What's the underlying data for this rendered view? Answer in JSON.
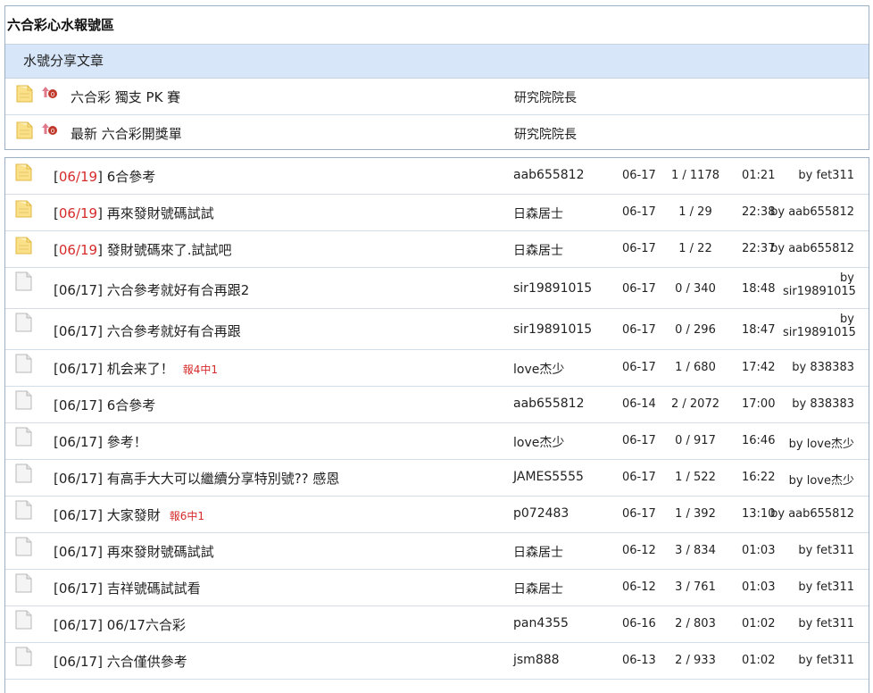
{
  "board": {
    "title": "六合彩心水報號區",
    "section_title": "水號分享文章",
    "pinned": [
      {
        "title": "六合彩 獨支 PK 賽",
        "author": "研究院院長"
      },
      {
        "title": "最新 六合彩開獎單",
        "author": "研究院院長"
      }
    ]
  },
  "colors": {
    "accent_red": "#d62b2b",
    "section_bg": "#d7e7f9",
    "border": "#9bb0c4"
  },
  "threads": [
    {
      "icon": "folder-new-icon",
      "date": "06/19",
      "hot": true,
      "title": "6合參考",
      "prize": "",
      "author": "aab655812",
      "posted": "06-17",
      "stats": "1 / 1178",
      "time": "01:21",
      "by": "by",
      "last_user": "fet311"
    },
    {
      "icon": "folder-new-icon",
      "date": "06/19",
      "hot": true,
      "title": "再來發財號碼試試",
      "prize": "",
      "author": "日森居士",
      "posted": "06-17",
      "stats": "1 / 29",
      "time": "22:38",
      "by": "by",
      "last_user": "aab655812"
    },
    {
      "icon": "folder-new-icon",
      "date": "06/19",
      "hot": true,
      "title": "發財號碼來了.試試吧",
      "prize": "",
      "author": "日森居士",
      "posted": "06-17",
      "stats": "1 / 22",
      "time": "22:37",
      "by": "by",
      "last_user": "aab655812"
    },
    {
      "icon": "document-icon",
      "date": "06/17",
      "hot": false,
      "title": "六合參考就好有合再跟2",
      "prize": "",
      "author": "sir19891015",
      "posted": "06-17",
      "stats": "0 / 340",
      "time": "18:48",
      "by": "by",
      "last_user": "sir19891015",
      "tall": true
    },
    {
      "icon": "document-icon",
      "date": "06/17",
      "hot": false,
      "title": "六合參考就好有合再跟",
      "prize": "",
      "author": "sir19891015",
      "posted": "06-17",
      "stats": "0 / 296",
      "time": "18:47",
      "by": "by",
      "last_user": "sir19891015",
      "tall": true
    },
    {
      "icon": "document-icon",
      "date": "06/17",
      "hot": false,
      "title": "机会来了！",
      "prize": "報4中1",
      "author": "love杰少",
      "posted": "06-17",
      "stats": "1 / 680",
      "time": "17:42",
      "by": "by",
      "last_user": "838383"
    },
    {
      "icon": "document-icon",
      "date": "06/17",
      "hot": false,
      "title": "6合參考",
      "prize": "",
      "author": "aab655812",
      "posted": "06-14",
      "stats": "2 / 2072",
      "time": "17:00",
      "by": "by",
      "last_user": "838383"
    },
    {
      "icon": "document-icon",
      "date": "06/17",
      "hot": false,
      "title": "參考！",
      "prize": "",
      "author": "love杰少",
      "posted": "06-17",
      "stats": "0 / 917",
      "time": "16:46",
      "by": "by",
      "last_user": "love杰少"
    },
    {
      "icon": "document-icon",
      "date": "06/17",
      "hot": false,
      "title": "有高手大大可以繼續分享特別號?? 感恩",
      "prize": "",
      "author": "JAMES5555",
      "posted": "06-17",
      "stats": "1 / 522",
      "time": "16:22",
      "by": "by",
      "last_user": "love杰少"
    },
    {
      "icon": "document-icon",
      "date": "06/17",
      "hot": false,
      "title": "大家發財",
      "prize": "報6中1",
      "author": "p072483",
      "posted": "06-17",
      "stats": "1 / 392",
      "time": "13:10",
      "by": "by",
      "last_user": "aab655812"
    },
    {
      "icon": "document-icon",
      "date": "06/17",
      "hot": false,
      "title": "再來發財號碼試試",
      "prize": "",
      "author": "日森居士",
      "posted": "06-12",
      "stats": "3 / 834",
      "time": "01:03",
      "by": "by",
      "last_user": "fet311"
    },
    {
      "icon": "document-icon",
      "date": "06/17",
      "hot": false,
      "title": "吉祥號碼試試看",
      "prize": "",
      "author": "日森居士",
      "posted": "06-12",
      "stats": "3 / 761",
      "time": "01:03",
      "by": "by",
      "last_user": "fet311"
    },
    {
      "icon": "document-icon",
      "date": "06/17",
      "hot": false,
      "title": "06/17六合彩",
      "prize": "",
      "author": "pan4355",
      "posted": "06-16",
      "stats": "2 / 803",
      "time": "01:02",
      "by": "by",
      "last_user": "fet311"
    },
    {
      "icon": "document-icon",
      "date": "06/17",
      "hot": false,
      "title": "六合僅供參考",
      "prize": "",
      "author": "jsm888",
      "posted": "06-13",
      "stats": "2 / 933",
      "time": "01:02",
      "by": "by",
      "last_user": "fet311"
    }
  ]
}
